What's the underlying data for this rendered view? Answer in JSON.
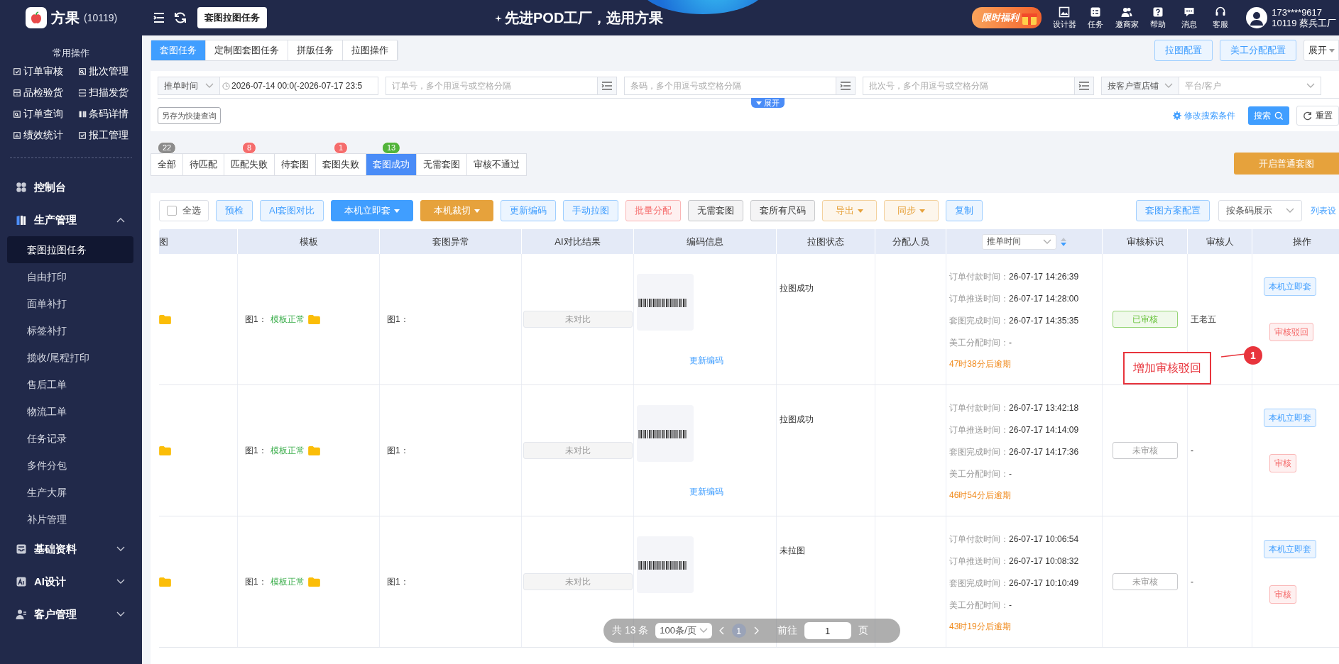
{
  "top_bar": {
    "logo": "方果",
    "account_id": "(10119)",
    "page_tab": "套图拉图任务",
    "slogan": "先进POD工厂，选用方果",
    "promo": "限时福利",
    "nav": [
      "设计器",
      "任务",
      "邀商家",
      "帮助",
      "消息",
      "客服"
    ],
    "user_phone": "173****9617",
    "user_org": "10119 蔡兵工厂"
  },
  "sidebar": {
    "quick_title": "常用操作",
    "quick_actions": [
      "订单审核",
      "批次管理",
      "品检验货",
      "扫描发货",
      "订单查询",
      "条码详情",
      "绩效统计",
      "报工管理"
    ],
    "menu": [
      {
        "label": "控制台",
        "kind": "link"
      },
      {
        "label": "生产管理",
        "kind": "group",
        "expanded": true,
        "children": [
          {
            "label": "套图拉图任务",
            "selected": true
          },
          {
            "label": "自由打印",
            "selected": false
          },
          {
            "label": "面单补打",
            "selected": false
          },
          {
            "label": "标签补打",
            "selected": false
          },
          {
            "label": "揽收/尾程打印",
            "selected": false
          },
          {
            "label": "售后工单",
            "selected": false
          },
          {
            "label": "物流工单",
            "selected": false
          },
          {
            "label": "任务记录",
            "selected": false
          },
          {
            "label": "多件分包",
            "selected": false
          },
          {
            "label": "生产大屏",
            "selected": false
          },
          {
            "label": "补片管理",
            "selected": false
          }
        ]
      },
      {
        "label": "基础资料",
        "kind": "group",
        "expanded": false
      },
      {
        "label": "AI设计",
        "kind": "group",
        "expanded": false
      },
      {
        "label": "客户管理",
        "kind": "group",
        "expanded": false
      }
    ]
  },
  "view_tabs": [
    {
      "label": "套图任务",
      "selected": true
    },
    {
      "label": "定制图套图任务",
      "selected": false
    },
    {
      "label": "拼版任务",
      "selected": false
    },
    {
      "label": "拉图操作",
      "selected": false
    }
  ],
  "header_buttons": [
    "拉图配置",
    "美工分配配置"
  ],
  "expand_dropdown": "展开",
  "filters": {
    "time_type": "推单时间",
    "date_range": "2026-07-14 00:0(-2026-07-17 23:5",
    "inputs": [
      {
        "placeholder": "订单号，多个用逗号或空格分隔"
      },
      {
        "placeholder": "条码，多个用逗号或空格分隔"
      },
      {
        "placeholder": "批次号，多个用逗号或空格分隔"
      }
    ],
    "shop_select": "按客户查店铺",
    "platform_placeholder": "平台/客户",
    "expand_toggle": "展开",
    "save_query": "另存为快捷查询",
    "edit_conditions": "修改搜索条件",
    "search": "搜索",
    "reset": "重置"
  },
  "status_tabs": [
    {
      "label": "全部",
      "count": "22",
      "color": "#8c8c8c",
      "selected": false
    },
    {
      "label": "待匹配",
      "selected": false
    },
    {
      "label": "匹配失败",
      "count": "8",
      "color": "#f56c6c",
      "selected": false
    },
    {
      "label": "待套图",
      "selected": false
    },
    {
      "label": "套图失败",
      "count": "1",
      "color": "#f56c6c",
      "selected": false
    },
    {
      "label": "套图成功",
      "count": "13",
      "color": "#52b43a",
      "selected": true
    },
    {
      "label": "无需套图",
      "selected": false
    },
    {
      "label": "审核不通过",
      "selected": false
    }
  ],
  "start_button": "开启普通套图",
  "toolbar": {
    "select_all": {
      "label": "全选",
      "checked": false
    },
    "buttons": [
      {
        "label": "预检",
        "kind": "light",
        "dropdown": false
      },
      {
        "label": "AI套图对比",
        "kind": "light",
        "dropdown": false
      },
      {
        "label": "本机立即套",
        "kind": "primary",
        "dropdown": true
      },
      {
        "label": "本机裁切",
        "kind": "orange",
        "dropdown": true
      },
      {
        "label": "更新编码",
        "kind": "light",
        "dropdown": false
      },
      {
        "label": "手动拉图",
        "kind": "light",
        "dropdown": false
      },
      {
        "label": "批量分配",
        "kind": "danger",
        "dropdown": false
      },
      {
        "label": "无需套图",
        "kind": "plain",
        "dropdown": false
      },
      {
        "label": "套所有尺码",
        "kind": "plain",
        "dropdown": false
      },
      {
        "label": "导出",
        "kind": "warning",
        "dropdown": true
      },
      {
        "label": "同步",
        "kind": "warning",
        "dropdown": true
      },
      {
        "label": "复制",
        "kind": "light",
        "dropdown": false
      }
    ],
    "scheme_button": "套图方案配置",
    "display_select": "按条码展示",
    "column_settings": "列表设"
  },
  "table": {
    "columns": [
      "图",
      "模板",
      "套图异常",
      "AI对比结果",
      "编码信息",
      "拉图状态",
      "分配人员",
      "推单时间",
      "审核标识",
      "审核人",
      "操作"
    ],
    "rows": [
      {
        "template_label": "图1：",
        "template_status": "模板正常",
        "anomaly": "图1：",
        "ai_result": "未对比",
        "barcode_link": "更新编码",
        "pull_status": "拉图成功",
        "times": [
          {
            "name": "订单付款时间：",
            "time": "26-07-17 14:26:39"
          },
          {
            "name": "订单推送时间：",
            "time": "26-07-17 14:28:00"
          },
          {
            "name": "套图完成时间：",
            "time": "26-07-17 14:35:35"
          },
          {
            "name": "美工分配时间：",
            "time": "-"
          }
        ],
        "overdue": "47时38分后逾期",
        "review": {
          "label": "已审核",
          "reviewed": true
        },
        "reviewer": "王老五",
        "actions": [
          {
            "label": "本机立即套",
            "kind": "primary"
          },
          {
            "label": "审核驳回",
            "kind": "danger"
          }
        ]
      },
      {
        "template_label": "图1：",
        "template_status": "模板正常",
        "anomaly": "图1：",
        "ai_result": "未对比",
        "barcode_link": "更新编码",
        "pull_status": "拉图成功",
        "times": [
          {
            "name": "订单付款时间：",
            "time": "26-07-17 13:42:18"
          },
          {
            "name": "订单推送时间：",
            "time": "26-07-17 14:14:09"
          },
          {
            "name": "套图完成时间：",
            "time": "26-07-17 14:17:36"
          },
          {
            "name": "美工分配时间：",
            "time": "-"
          }
        ],
        "overdue": "46时54分后逾期",
        "review": {
          "label": "未审核",
          "reviewed": false
        },
        "reviewer": "-",
        "actions": [
          {
            "label": "本机立即套",
            "kind": "primary"
          },
          {
            "label": "审核",
            "kind": "danger"
          }
        ]
      },
      {
        "template_label": "图1：",
        "template_status": "模板正常",
        "anomaly": "图1：",
        "ai_result": "未对比",
        "pull_status": "未拉图",
        "times": [
          {
            "name": "订单付款时间：",
            "time": "26-07-17 10:06:54"
          },
          {
            "name": "订单推送时间：",
            "time": "26-07-17 10:08:32"
          },
          {
            "name": "套图完成时间：",
            "time": "26-07-17 10:10:49"
          },
          {
            "name": "美工分配时间：",
            "time": "-"
          }
        ],
        "overdue": "43时19分后逾期",
        "review": {
          "label": "未审核",
          "reviewed": false
        },
        "reviewer": "-",
        "actions": [
          {
            "label": "本机立即套",
            "kind": "primary"
          },
          {
            "label": "审核",
            "kind": "danger"
          }
        ]
      }
    ]
  },
  "pagination": {
    "total": "共 13 条",
    "page_size": "100条/页",
    "pages": [
      {
        "label": "1",
        "selected": true
      }
    ],
    "goto": "前往",
    "goto_value": "1",
    "suffix": "页"
  },
  "annotation": {
    "text": "增加审核驳回",
    "number": "1"
  }
}
